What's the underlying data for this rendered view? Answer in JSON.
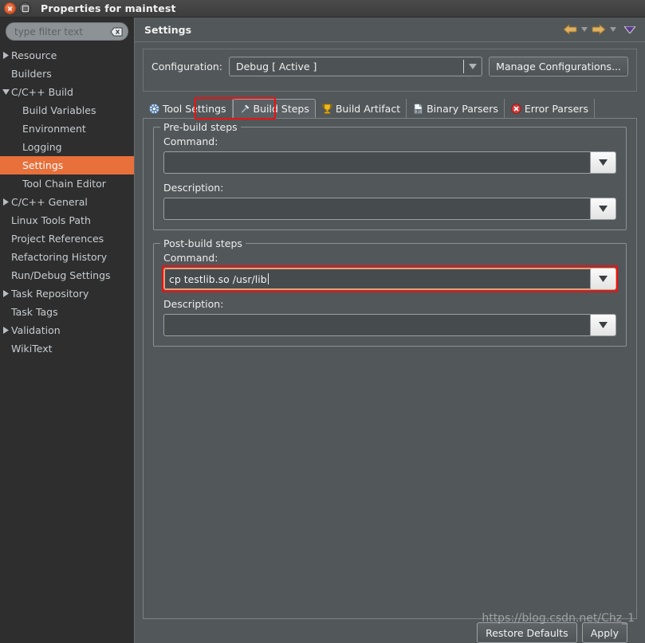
{
  "window": {
    "title": "Properties for maintest",
    "close_icon": "close-icon",
    "maximize_icon": "maximize-icon"
  },
  "sidebar": {
    "filter": {
      "placeholder": "type filter text",
      "value": "",
      "clear_icon": "clear-filter-icon"
    },
    "items": [
      {
        "label": "Resource",
        "indent": 0,
        "twisty": "collapsed",
        "selected": false
      },
      {
        "label": "Builders",
        "indent": 0,
        "twisty": "none",
        "selected": false
      },
      {
        "label": "C/C++ Build",
        "indent": 0,
        "twisty": "expanded",
        "selected": false
      },
      {
        "label": "Build Variables",
        "indent": 1,
        "twisty": "none",
        "selected": false
      },
      {
        "label": "Environment",
        "indent": 1,
        "twisty": "none",
        "selected": false
      },
      {
        "label": "Logging",
        "indent": 1,
        "twisty": "none",
        "selected": false
      },
      {
        "label": "Settings",
        "indent": 1,
        "twisty": "none",
        "selected": true
      },
      {
        "label": "Tool Chain Editor",
        "indent": 1,
        "twisty": "none",
        "selected": false
      },
      {
        "label": "C/C++ General",
        "indent": 0,
        "twisty": "collapsed",
        "selected": false
      },
      {
        "label": "Linux Tools Path",
        "indent": 0,
        "twisty": "none",
        "selected": false
      },
      {
        "label": "Project References",
        "indent": 0,
        "twisty": "none",
        "selected": false
      },
      {
        "label": "Refactoring History",
        "indent": 0,
        "twisty": "none",
        "selected": false
      },
      {
        "label": "Run/Debug Settings",
        "indent": 0,
        "twisty": "none",
        "selected": false
      },
      {
        "label": "Task Repository",
        "indent": 0,
        "twisty": "collapsed",
        "selected": false
      },
      {
        "label": "Task Tags",
        "indent": 0,
        "twisty": "none",
        "selected": false
      },
      {
        "label": "Validation",
        "indent": 0,
        "twisty": "collapsed",
        "selected": false
      },
      {
        "label": "WikiText",
        "indent": 0,
        "twisty": "none",
        "selected": false
      }
    ]
  },
  "header": {
    "title": "Settings",
    "nav": [
      {
        "name": "back-arrow-icon",
        "kind": "arrow-left"
      },
      {
        "name": "back-history-dropdown-icon",
        "kind": "caret"
      },
      {
        "name": "forward-arrow-icon",
        "kind": "arrow-right"
      },
      {
        "name": "forward-history-dropdown-icon",
        "kind": "caret"
      },
      {
        "name": "view-menu-icon",
        "kind": "menu"
      }
    ]
  },
  "config": {
    "label": "Configuration:",
    "value": "Debug  [ Active ]",
    "dropdown_icon": "chevron-down-icon",
    "manage_button": "Manage Configurations..."
  },
  "tabs": [
    {
      "label": "Tool Settings",
      "icon": "tool-settings-icon",
      "active": false
    },
    {
      "label": "Build Steps",
      "icon": "build-steps-icon",
      "active": true
    },
    {
      "label": "Build Artifact",
      "icon": "build-artifact-icon",
      "active": false
    },
    {
      "label": "Binary Parsers",
      "icon": "binary-parsers-icon",
      "active": false
    },
    {
      "label": "Error Parsers",
      "icon": "error-parsers-icon",
      "active": false
    }
  ],
  "groups": [
    {
      "title": "Pre-build steps",
      "command_label": "Command:",
      "command_value": "",
      "description_label": "Description:",
      "description_value": "",
      "highlighted": false
    },
    {
      "title": "Post-build steps",
      "command_label": "Command:",
      "command_value": "cp testlib.so /usr/lib",
      "description_label": "Description:",
      "description_value": "",
      "highlighted": true
    }
  ],
  "footer": {
    "restore_defaults": "Restore Defaults",
    "apply": "Apply",
    "watermark": "https://blog.csdn.net/Chz_1"
  },
  "colors": {
    "accent": "#e8703a",
    "highlight_box": "#ee1111",
    "panel_bg": "#52575a",
    "sidebar_bg": "#2e2e2e"
  }
}
